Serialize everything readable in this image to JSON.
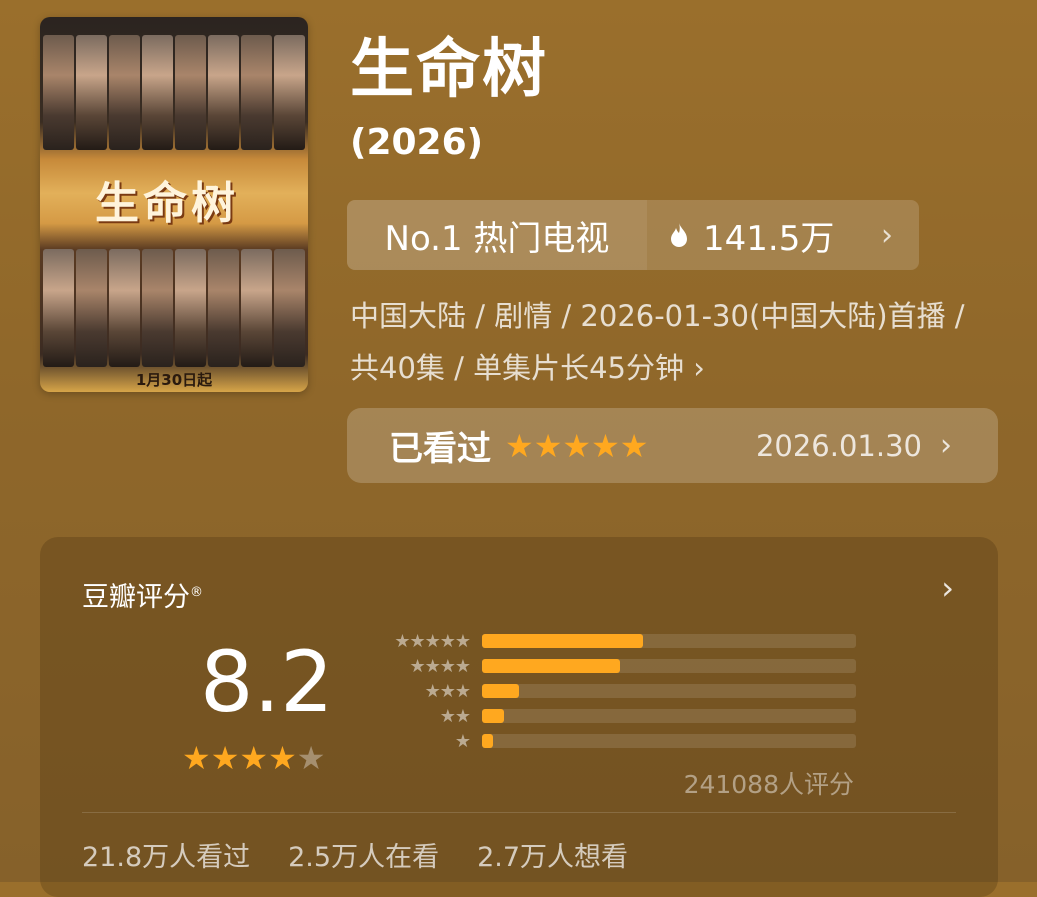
{
  "poster": {
    "title_art": "生命树",
    "date_text": "1月30日起"
  },
  "show": {
    "title": "生命树",
    "year": "(2026)"
  },
  "rank": {
    "label": "No.1 热门电视",
    "heat": "141.5万",
    "chevron": "›",
    "icon": "fire-icon"
  },
  "meta": {
    "text": "中国大陆 / 剧情 / 2026-01-30(中国大陆)首播 / 共40集 / 单集片长45分钟",
    "chevron": "›"
  },
  "watched": {
    "label": "已看过",
    "stars": "★★★★★",
    "user_rating": 5,
    "date": "2026.01.30",
    "chevron": "›"
  },
  "rating": {
    "title": "豆瓣评分",
    "trademark": "®",
    "chevron": "›",
    "score": "8.2",
    "stars_filled": "★★★★",
    "stars_empty": "★",
    "distribution": [
      {
        "stars": "★★★★★",
        "fraction": 0.43
      },
      {
        "stars": "★★★★",
        "fraction": 0.37
      },
      {
        "stars": "★★★",
        "fraction": 0.1
      },
      {
        "stars": "★★",
        "fraction": 0.06
      },
      {
        "stars": "★",
        "fraction": 0.03
      }
    ],
    "votes": "241088人评分",
    "watched_count": "21.8万人看过",
    "watching_count": "2.5万人在看",
    "want_count": "2.7万人想看"
  },
  "colors": {
    "accent": "#ffa81f",
    "background": "#8f672a"
  }
}
